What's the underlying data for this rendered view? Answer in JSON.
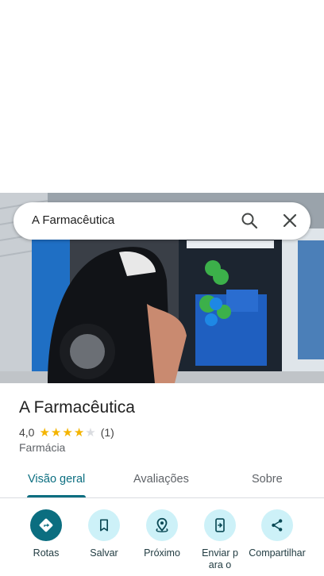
{
  "search": {
    "query": "A Farmacêutica"
  },
  "place": {
    "name": "A Farmacêutica",
    "rating_value": "4,0",
    "rating_stars": 4,
    "review_count": "(1)",
    "category": "Farmácia"
  },
  "tabs": [
    {
      "label": "Visão geral",
      "active": true
    },
    {
      "label": "Avaliações",
      "active": false
    },
    {
      "label": "Sobre",
      "active": false
    }
  ],
  "actions": [
    {
      "label": "Rotas",
      "icon": "directions-icon"
    },
    {
      "label": "Salvar",
      "icon": "bookmark-icon"
    },
    {
      "label": "Próximo",
      "icon": "nearby-icon"
    },
    {
      "label": "Enviar para o",
      "icon": "send-to-phone-icon"
    },
    {
      "label": "Compartilhar",
      "icon": "share-icon"
    }
  ],
  "colors": {
    "accent": "#0b6e80",
    "action_bg": "#cdf1f8",
    "star": "#f4b400",
    "star_empty": "#dadce0"
  }
}
